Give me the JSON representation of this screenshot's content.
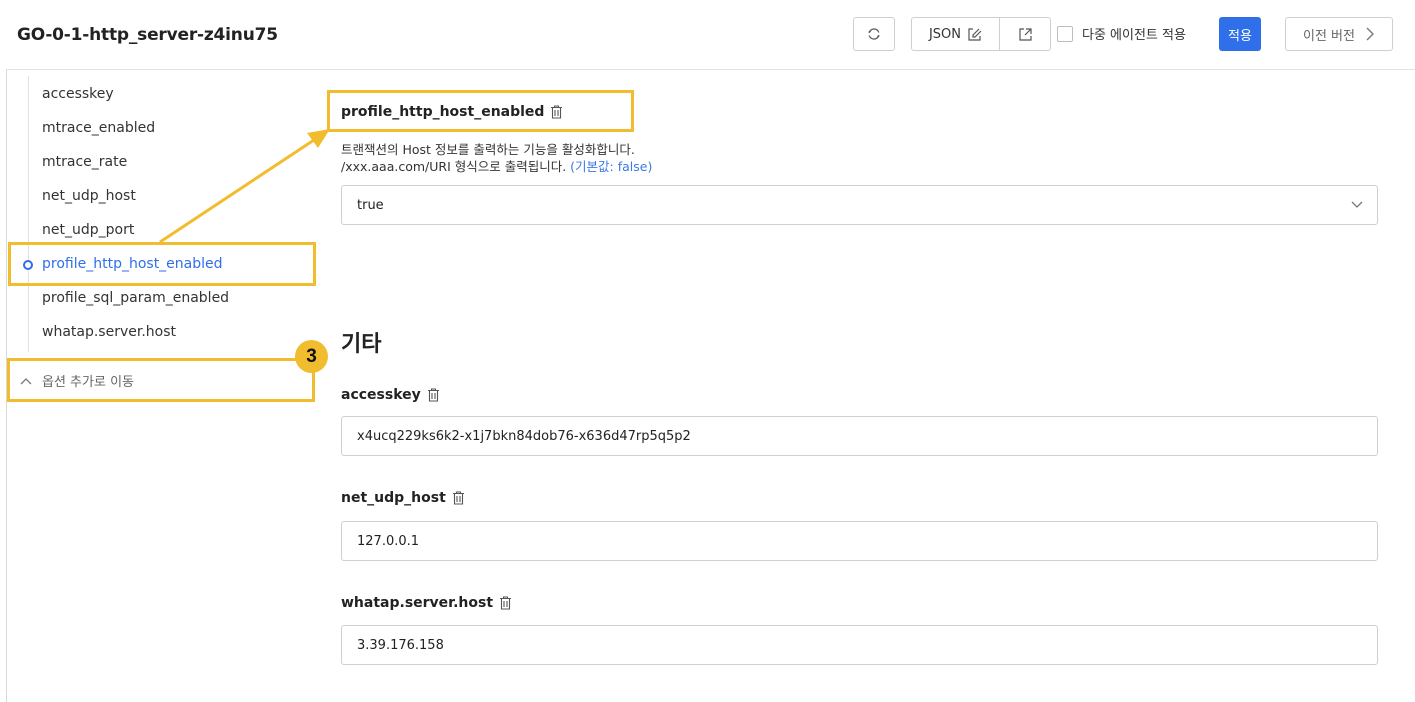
{
  "header": {
    "title": "GO-0-1-http_server-z4inu75",
    "json_label": "JSON",
    "multi_agent_label": "다중 에이전트 적용",
    "apply_label": "적용",
    "prev_version_label": "이전 버전"
  },
  "sidebar": {
    "items": [
      {
        "label": "accesskey"
      },
      {
        "label": "mtrace_enabled"
      },
      {
        "label": "mtrace_rate"
      },
      {
        "label": "net_udp_host"
      },
      {
        "label": "net_udp_port"
      },
      {
        "label": "profile_http_host_enabled"
      },
      {
        "label": "profile_sql_param_enabled"
      },
      {
        "label": "whatap.server.host"
      }
    ],
    "active_item": "profile_http_host_enabled",
    "collapse_label": "옵션 추가로 이동"
  },
  "annotation": {
    "step_number": "3",
    "highlight_color": "#f1bd2f"
  },
  "main": {
    "profile_field": {
      "label": "profile_http_host_enabled",
      "desc_line1": "트랜잭션의 Host 정보를 출력하는 기능을 활성화합니다.",
      "desc_line2": "/xxx.aaa.com/URI 형식으로 출력됩니다.",
      "default_text": "(기본값: false)",
      "value": "true"
    },
    "section_title": "기타",
    "fields": [
      {
        "label": "accesskey",
        "value": "x4ucq229ks6k2-x1j7bkn84dob76-x636d47rp5q5p2"
      },
      {
        "label": "net_udp_host",
        "value": "127.0.0.1"
      },
      {
        "label": "whatap.server.host",
        "value": "3.39.176.158"
      }
    ]
  },
  "colors": {
    "accent": "#2f6fea",
    "highlight": "#f1bd2f"
  }
}
